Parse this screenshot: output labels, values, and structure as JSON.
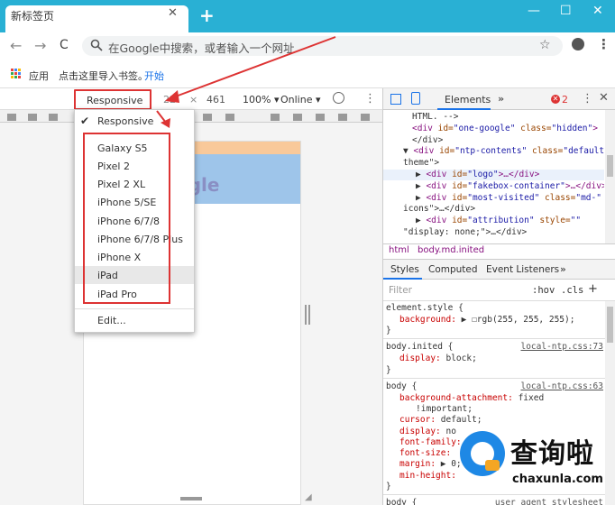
{
  "browser": {
    "tab_title": "新标签页",
    "tab_close": "✕",
    "new_tab": "+",
    "window_controls": [
      "—",
      "☐",
      "✕"
    ],
    "nav": {
      "back": "←",
      "forward": "→",
      "reload": "C"
    },
    "omnibox_placeholder": "在Google中搜索，或者输入一个网址",
    "star": "☆",
    "menu": "⋮"
  },
  "bookmarks": {
    "apps_label": "应用",
    "hint": "点击这里导入书签。",
    "start_link": "开始"
  },
  "device_toolbar": {
    "device": "Responsive ▾",
    "width": "22",
    "times": "×",
    "height": "461",
    "zoom": "100% ▾",
    "network": "Online ▾",
    "more": "⋮"
  },
  "device_menu": {
    "checked_item": "Responsive",
    "devices": [
      "Galaxy S5",
      "Pixel 2",
      "Pixel 2 XL",
      "iPhone 5/SE",
      "iPhone 6/7/8",
      "iPhone 6/7/8 Plus",
      "iPhone X",
      "iPad",
      "iPad Pro"
    ],
    "edit": "Edit..."
  },
  "viewport": {
    "logo_text": "ogle"
  },
  "devtools": {
    "tab_elements": "Elements",
    "more_tabs": "»",
    "error_count": "2",
    "error_icon": "✕",
    "kebab": "⋮",
    "close": "✕",
    "dom_lines": [
      {
        "pre": "HTML. -->",
        "tag": "",
        "attrs": []
      },
      {
        "pre": "",
        "tag": "div",
        "attrs": [
          [
            "id",
            "one-google"
          ],
          [
            "class",
            "hidden"
          ]
        ],
        "suffix": ">"
      },
      {
        "pre": "</div>",
        "tag": "",
        "attrs": []
      },
      {
        "pre": "▼",
        "tag": "div",
        "attrs": [
          [
            "id",
            "ntp-contents"
          ],
          [
            "class",
            "default-"
          ]
        ]
      },
      {
        "pre": "theme\">",
        "tag": "",
        "attrs": []
      },
      {
        "pre": "▶",
        "tag": "div",
        "attrs": [
          [
            "id",
            "logo"
          ]
        ],
        "suffix": ">…</div>"
      },
      {
        "pre": "▶",
        "tag": "div",
        "attrs": [
          [
            "id",
            "fakebox-container"
          ]
        ],
        "suffix": ">…</div>"
      },
      {
        "pre": "▶",
        "tag": "div",
        "attrs": [
          [
            "id",
            "most-visited"
          ],
          [
            "class",
            "md-"
          ]
        ]
      },
      {
        "pre": "icons\">…</div>",
        "tag": "",
        "attrs": []
      },
      {
        "pre": "▶",
        "tag": "div",
        "attrs": [
          [
            "id",
            "attribution"
          ],
          [
            "style",
            ""
          ]
        ]
      },
      {
        "pre": "\"display: none;\">…</div>",
        "tag": "",
        "attrs": []
      }
    ],
    "crumbs": [
      "html",
      "body.md.inited"
    ],
    "styles_tabs": [
      "Styles",
      "Computed",
      "Event Listeners",
      "»"
    ],
    "filter_placeholder": "Filter",
    "hov": ":hov",
    "cls": ".cls",
    "plus": "+",
    "rules": [
      {
        "selector": "element.style {",
        "source": "",
        "props": [
          [
            "background",
            "▶ ☐rgb(255, 255, 255);"
          ]
        ]
      },
      {
        "selector": "body.inited {",
        "source": "local-ntp.css:73",
        "props": [
          [
            "display",
            "block;"
          ]
        ]
      },
      {
        "selector": "body {",
        "source": "local-ntp.css:63",
        "props": [
          [
            "background-attachment",
            "fixed"
          ],
          [
            "",
            "!important;"
          ],
          [
            "cursor",
            "default;"
          ],
          [
            "display",
            "no"
          ],
          [
            "font-family",
            ""
          ],
          [
            "font-size",
            ""
          ],
          [
            "margin",
            "▶ 0;"
          ],
          [
            "min-height",
            ""
          ]
        ]
      },
      {
        "selector": "body {",
        "source": "user agent stylesheet",
        "props": []
      }
    ]
  },
  "watermark": {
    "text": "查询啦",
    "url": "chaxunla.com"
  },
  "colors": {
    "accent": "#29b0d4",
    "highlight_red": "#d33333",
    "link_blue": "#1a73e8"
  }
}
